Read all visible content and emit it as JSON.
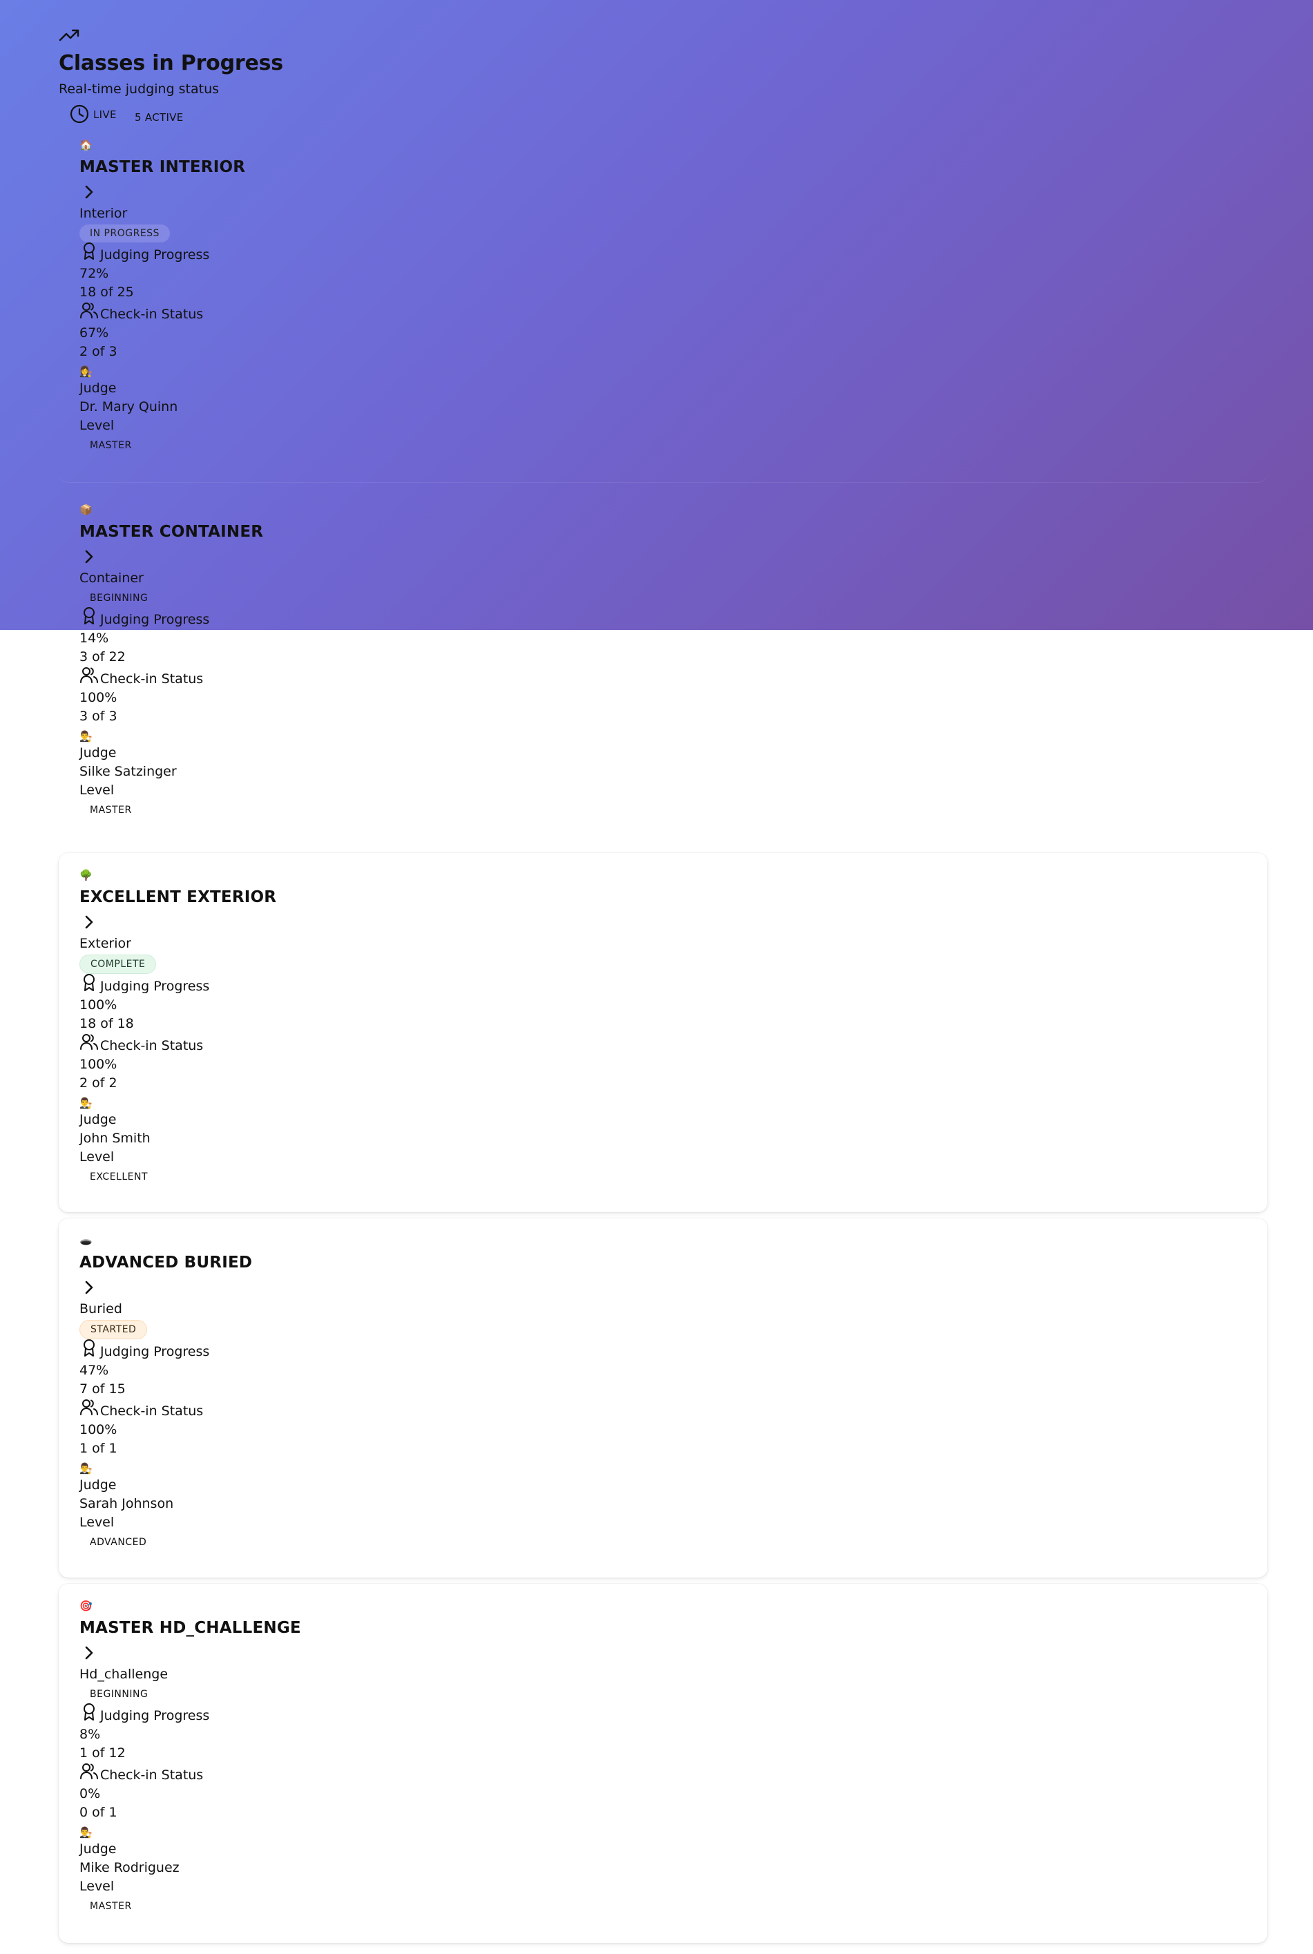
{
  "header": {
    "icon": "trending-up-icon",
    "title": "Classes in Progress",
    "subtitle": "Real-time judging status",
    "live_label": "LIVE",
    "active_label": "5 ACTIVE"
  },
  "labels": {
    "judging_progress": "Judging Progress",
    "checkin_status": "Check-in Status",
    "judge": "Judge",
    "level": "Level"
  },
  "colors": {
    "hero_gradient_start": "#6a7ee6",
    "hero_gradient_end": "#7650a6",
    "in_progress_badge": "#8c91e6",
    "complete_badge": "#e4f7ea",
    "started_badge": "#fff1e0"
  },
  "classes": [
    {
      "icon": "house-icon",
      "icon_glyph": "🏠",
      "name": "MASTER INTERIOR",
      "type": "Interior",
      "status": "IN PROGRESS",
      "judging_percent": "72%",
      "judging_count": "18 of 25",
      "checkin_percent": "67%",
      "checkin_count": "2 of 3",
      "judge_icon": "judge-avatar-icon",
      "judge_glyph": "👩‍⚖️",
      "judge_name": "Dr. Mary Quinn",
      "level": "MASTER"
    },
    {
      "icon": "box-icon",
      "icon_glyph": "📦",
      "name": "MASTER CONTAINER",
      "type": "Container",
      "status": "BEGINNING",
      "judging_percent": "14%",
      "judging_count": "3 of 22",
      "checkin_percent": "100%",
      "checkin_count": "3 of 3",
      "judge_icon": "judge-avatar-icon",
      "judge_glyph": "👨‍⚖️",
      "judge_name": "Silke Satzinger",
      "level": "MASTER"
    },
    {
      "icon": "tree-icon",
      "icon_glyph": "🌳",
      "name": "EXCELLENT EXTERIOR",
      "type": "Exterior",
      "status": "COMPLETE",
      "judging_percent": "100%",
      "judging_count": "18 of 18",
      "checkin_percent": "100%",
      "checkin_count": "2 of 2",
      "judge_icon": "judge-avatar-icon",
      "judge_glyph": "👨‍⚖️",
      "judge_name": "John Smith",
      "level": "EXCELLENT"
    },
    {
      "icon": "hole-icon",
      "icon_glyph": "🕳️",
      "name": "ADVANCED BURIED",
      "type": "Buried",
      "status": "STARTED",
      "judging_percent": "47%",
      "judging_count": "7 of 15",
      "checkin_percent": "100%",
      "checkin_count": "1 of 1",
      "judge_icon": "judge-avatar-icon",
      "judge_glyph": "👨‍⚖️",
      "judge_name": "Sarah Johnson",
      "level": "ADVANCED"
    },
    {
      "icon": "target-icon",
      "icon_glyph": "🎯",
      "name": "MASTER HD_CHALLENGE",
      "type": "Hd_challenge",
      "status": "BEGINNING",
      "judging_percent": "8%",
      "judging_count": "1 of 12",
      "checkin_percent": "0%",
      "checkin_count": "0 of 1",
      "judge_icon": "judge-avatar-icon",
      "judge_glyph": "👨‍⚖️",
      "judge_name": "Mike Rodriguez",
      "level": "MASTER"
    }
  ]
}
